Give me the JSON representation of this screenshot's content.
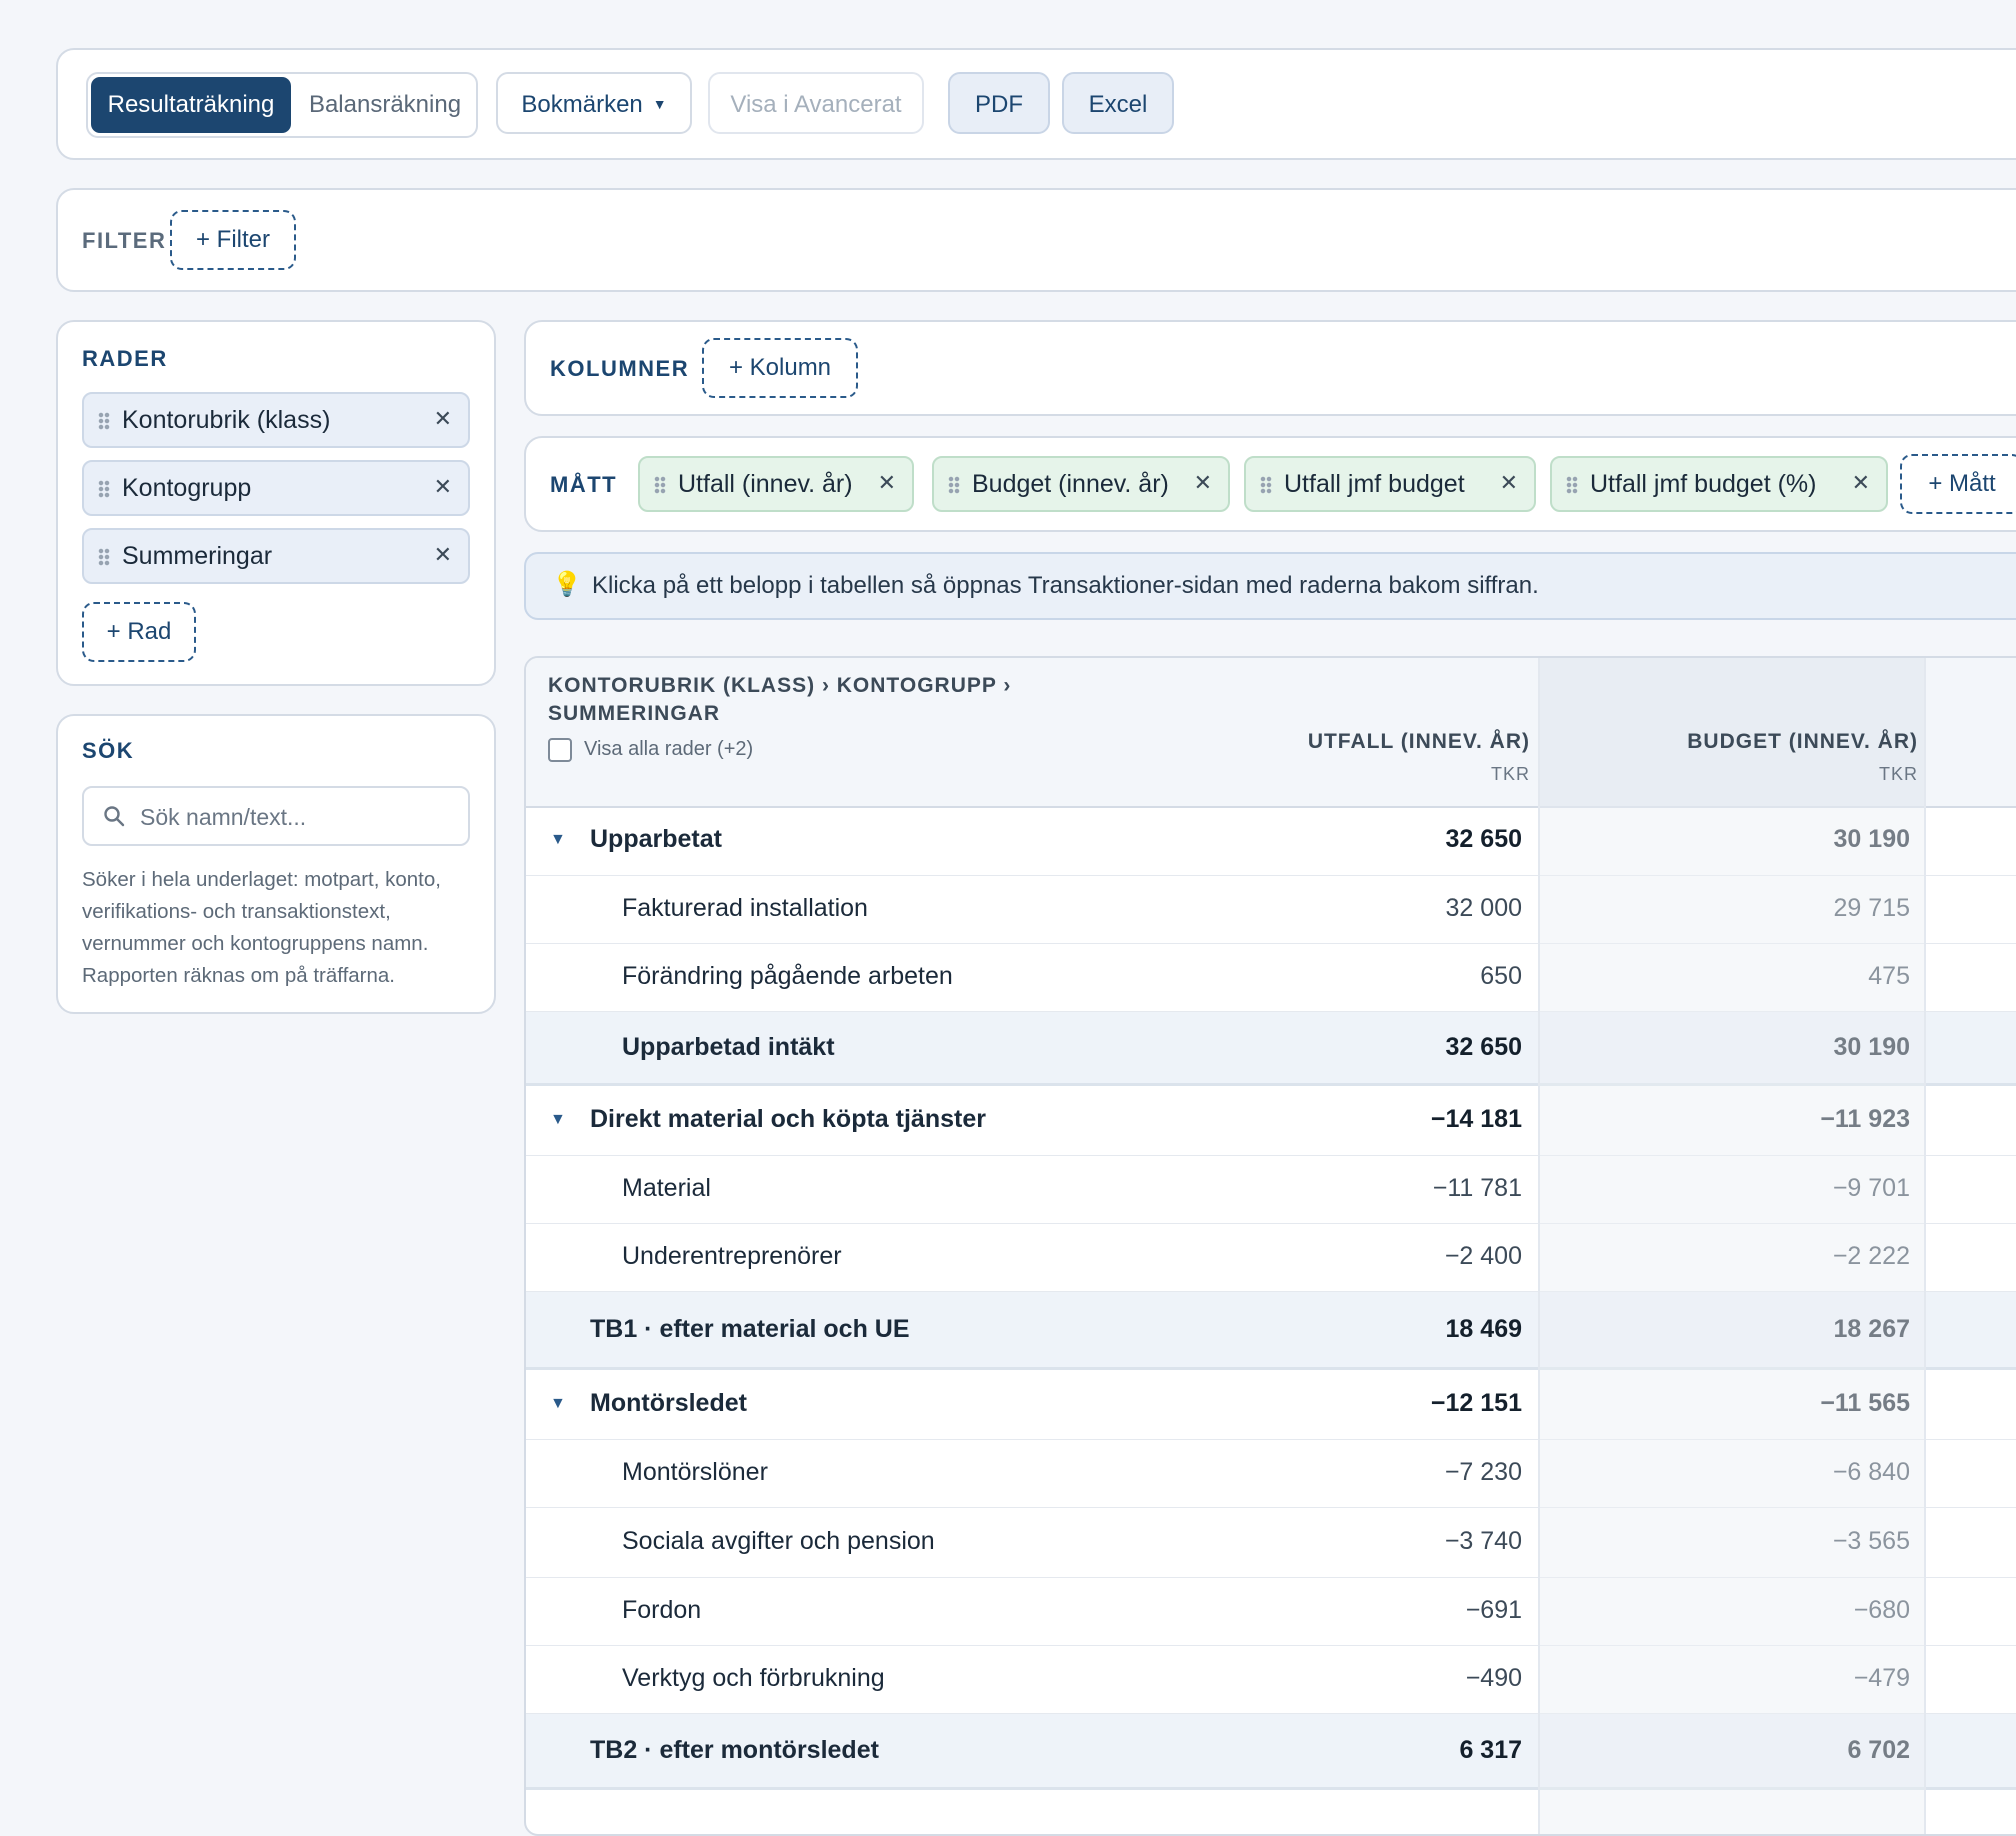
{
  "toolbar": {
    "tab_active": "Resultaträkning",
    "tab_inactive": "Balansräkning",
    "bookmarks": "Bokmärken",
    "advanced": "Visa i Avancerat",
    "pdf": "PDF",
    "excel": "Excel"
  },
  "filter": {
    "label": "FILTER",
    "add": "+ Filter"
  },
  "rows_panel": {
    "label": "RADER",
    "chips": [
      "Kontorubrik (klass)",
      "Kontogrupp",
      "Summeringar"
    ],
    "add": "+ Rad"
  },
  "search": {
    "label": "SÖK",
    "placeholder": "Sök namn/text...",
    "help": "Söker i hela underlaget: motpart, konto, verifikations- och transaktionstext, vernummer och kontogruppens namn. Rapporten räknas om på träffarna."
  },
  "columns_panel": {
    "label": "KOLUMNER",
    "add": "+ Kolumn"
  },
  "measures_panel": {
    "label": "MÅTT",
    "chips": [
      "Utfall (innev. år)",
      "Budget (innev. år)",
      "Utfall jmf budget",
      "Utfall jmf budget (%)"
    ],
    "add": "+ Mått"
  },
  "tip": {
    "icon": "lightbulb-icon",
    "text": "Klicka på ett belopp i tabellen så öppnas Transaktioner-sidan med raderna bakom siffran."
  },
  "table": {
    "header_path_1": "KONTORUBRIK (KLASS) › KONTOGRUPP ›",
    "header_path_2": "SUMMERINGAR",
    "show_all": "Visa alla rader (+2)",
    "col1_title": "UTFALL (INNEV. ÅR)",
    "col1_unit": "TKR",
    "col2_title": "BUDGET (INNEV. ÅR)",
    "col2_unit": "TKR",
    "rows": [
      {
        "label": "Upparbetat",
        "utfall": "32 650",
        "budget": "30 190"
      },
      {
        "label": "Fakturerad installation",
        "utfall": "32 000",
        "budget": "29 715"
      },
      {
        "label": "Förändring pågående arbeten",
        "utfall": "650",
        "budget": "475"
      },
      {
        "label": "Upparbetad intäkt",
        "utfall": "32 650",
        "budget": "30 190"
      },
      {
        "label": "Direkt material och köpta tjänster",
        "utfall": "−14 181",
        "budget": "−11 923"
      },
      {
        "label": "Material",
        "utfall": "−11 781",
        "budget": "−9 701"
      },
      {
        "label": "Underentreprenörer",
        "utfall": "−2 400",
        "budget": "−2 222"
      },
      {
        "label": "TB1 · efter material och UE",
        "utfall": "18 469",
        "budget": "18 267"
      },
      {
        "label": "Montörsledet",
        "utfall": "−12 151",
        "budget": "−11 565"
      },
      {
        "label": "Montörslöner",
        "utfall": "−7 230",
        "budget": "−6 840"
      },
      {
        "label": "Sociala avgifter och pension",
        "utfall": "−3 740",
        "budget": "−3 565"
      },
      {
        "label": "Fordon",
        "utfall": "−691",
        "budget": "−680"
      },
      {
        "label": "Verktyg och förbrukning",
        "utfall": "−490",
        "budget": "−479"
      },
      {
        "label": "TB2 · efter montörsledet",
        "utfall": "6 317",
        "budget": "6 702"
      }
    ]
  },
  "colors": {
    "accent": "#1c4670",
    "chip_blue": "#e9eff8",
    "chip_green": "#e6f4ea",
    "sum_row": "#eef3f9"
  }
}
